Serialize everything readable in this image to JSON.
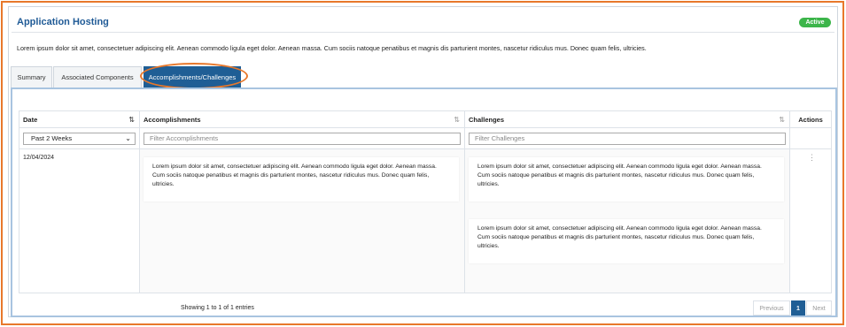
{
  "header": {
    "title": "Application Hosting",
    "status": "Active",
    "description": "Lorem ipsum dolor sit amet, consectetuer adipiscing elit. Aenean commodo ligula eget dolor. Aenean massa. Cum sociis natoque penatibus et magnis dis parturient montes, nascetur ridiculus mus. Donec quam felis, ultricies."
  },
  "tabs": [
    {
      "label": "Summary"
    },
    {
      "label": "Associated Components"
    },
    {
      "label": "Accomplishments/Challenges"
    }
  ],
  "table": {
    "columns": {
      "date": "Date",
      "accomplishments": "Accomplishments",
      "challenges": "Challenges",
      "actions": "Actions"
    },
    "filters": {
      "date_select": "Past 2 Weeks",
      "accomplishments_placeholder": "Filter Accomplishments",
      "challenges_placeholder": "Filter Challenges"
    },
    "rows": [
      {
        "date": "12/04/2024",
        "accomplishments": [
          "Lorem ipsum dolor sit amet, consectetuer adipiscing elit. Aenean commodo ligula eget dolor. Aenean massa. Cum sociis natoque penatibus et magnis dis parturient montes, nascetur ridiculus mus. Donec quam felis, ultricies."
        ],
        "challenges": [
          "Lorem ipsum dolor sit amet, consectetuer adipiscing elit. Aenean commodo ligula eget dolor. Aenean massa. Cum sociis natoque penatibus et magnis dis parturient montes, nascetur ridiculus mus. Donec quam felis, ultricies.",
          "Lorem ipsum dolor sit amet, consectetuer adipiscing elit. Aenean commodo ligula eget dolor. Aenean massa. Cum sociis natoque penatibus et magnis dis parturient montes, nascetur ridiculus mus. Donec quam felis, ultricies."
        ]
      }
    ]
  },
  "footer": {
    "info": "Showing 1 to 1 of 1 entries",
    "previous": "Previous",
    "page": "1",
    "next": "Next"
  },
  "colors": {
    "accent": "#1f5e95",
    "status": "#3cb54a",
    "highlight": "#e8782b"
  }
}
